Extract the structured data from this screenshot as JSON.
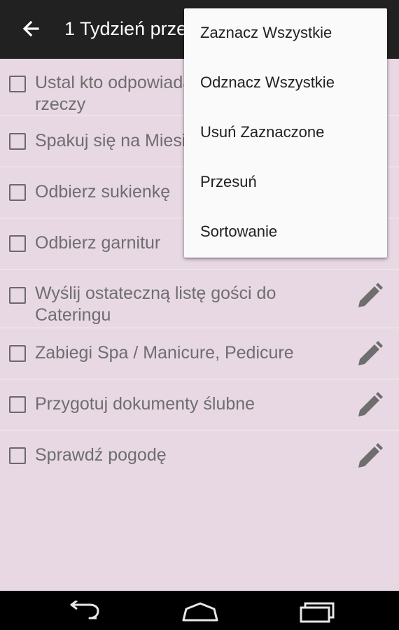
{
  "appbar": {
    "title": "1 Tydzień przed",
    "back_icon": "arrow-back-icon"
  },
  "tasks": [
    {
      "label": "Ustal kto odpowiada za odebranie rzeczy",
      "checked": false
    },
    {
      "label": "Spakuj się na Miesiąc Miodowy",
      "checked": false
    },
    {
      "label": "Odbierz sukienkę",
      "checked": false
    },
    {
      "label": "Odbierz garnitur",
      "checked": false
    },
    {
      "label": "Wyślij ostateczną listę gości do Cateringu",
      "checked": false
    },
    {
      "label": "Zabiegi Spa / Manicure, Pedicure",
      "checked": false
    },
    {
      "label": "Przygotuj dokumenty ślubne",
      "checked": false
    },
    {
      "label": "Sprawdź pogodę",
      "checked": false
    }
  ],
  "overflow_menu": {
    "items": [
      {
        "label": "Zaznacz Wszystkie"
      },
      {
        "label": "Odznacz Wszystkie"
      },
      {
        "label": "Usuń Zaznaczone"
      },
      {
        "label": "Przesuń"
      },
      {
        "label": "Sortowanie"
      }
    ]
  },
  "navbar": {
    "back_icon": "nav-back-icon",
    "home_icon": "nav-home-icon",
    "recents_icon": "nav-recents-icon"
  },
  "colors": {
    "appbar": "#212121",
    "list_background": "#e8d8e4",
    "text": "#6e6e6e",
    "menu_background": "#fafafa"
  }
}
